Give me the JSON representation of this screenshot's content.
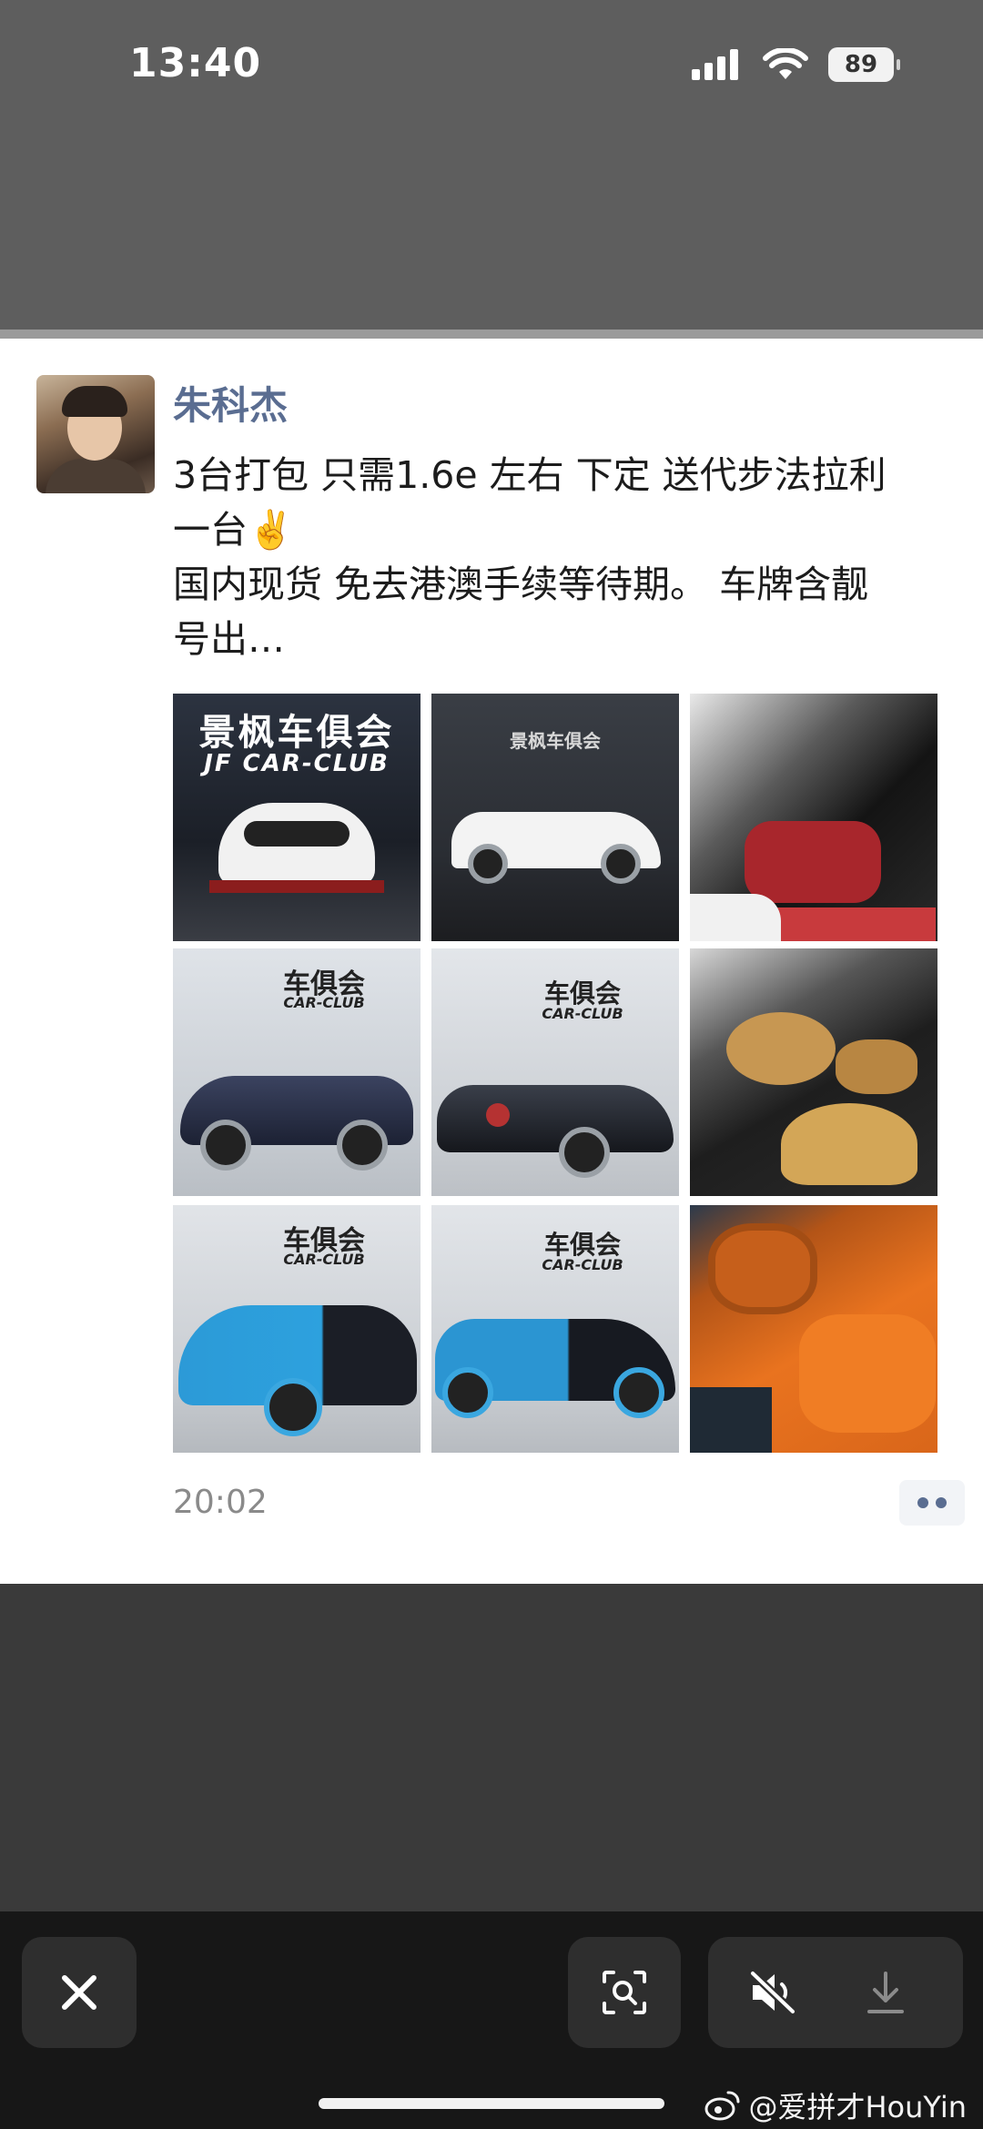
{
  "status_bar": {
    "time": "13:40",
    "battery": "89"
  },
  "post": {
    "username": "朱科杰",
    "lines": [
      "3台打包 只需1.6e 左右 下定 送代步法拉利",
      "一台✌️",
      "国内现货 免去港澳手续等待期。 车牌含靓",
      "号出…"
    ],
    "timestamp": "20:02"
  },
  "images": [
    {
      "caption_main": "景枫车俱会",
      "caption_sub": "JF CAR-CLUB"
    },
    {
      "caption_main": "景枫车俱会"
    },
    {},
    {
      "caption_main": "车俱会",
      "caption_sub": "CAR-CLUB"
    },
    {
      "caption_main": "车俱会",
      "caption_sub": "CAR-CLUB"
    },
    {},
    {
      "caption_main": "车俱会",
      "caption_sub": "CAR-CLUB"
    },
    {
      "caption_main": "车俱会",
      "caption_sub": "CAR-CLUB"
    },
    {}
  ],
  "watermark": "@爱拼才HouYin",
  "icons": {
    "close": "close-icon",
    "lens": "image-search-icon",
    "mute": "speaker-mute-icon",
    "download": "download-icon"
  }
}
